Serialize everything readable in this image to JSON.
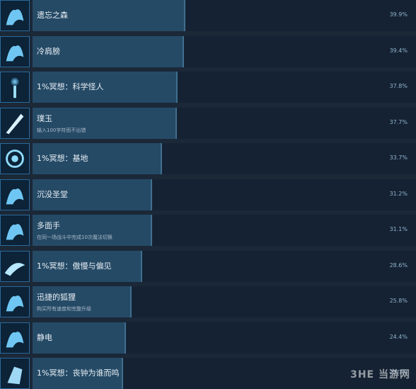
{
  "achievements": [
    {
      "name": "遗忘之森",
      "desc": "",
      "percent": "39.9%",
      "fill": 0.399,
      "icon": "wolf-forest-icon"
    },
    {
      "name": "冷肩膀",
      "desc": "",
      "percent": "39.4%",
      "fill": 0.394,
      "icon": "cold-shoulder-icon"
    },
    {
      "name": "1%冥想：科学怪人",
      "desc": "",
      "percent": "37.8%",
      "fill": 0.378,
      "icon": "lightning-tower-icon"
    },
    {
      "name": "璞玉",
      "desc": "输入100字符而不出错",
      "percent": "37.7%",
      "fill": 0.377,
      "icon": "quill-icon"
    },
    {
      "name": "1%冥想：基地",
      "desc": "",
      "percent": "33.7%",
      "fill": 0.337,
      "icon": "vortex-base-icon"
    },
    {
      "name": "沉没圣堂",
      "desc": "",
      "percent": "31.2%",
      "fill": 0.312,
      "icon": "sunken-temple-icon"
    },
    {
      "name": "多面手",
      "desc": "在同一场战斗中完成10次魔法切换",
      "percent": "31.1%",
      "fill": 0.311,
      "icon": "multitask-icon"
    },
    {
      "name": "1%冥想：傲慢与偏见",
      "desc": "",
      "percent": "28.6%",
      "fill": 0.286,
      "icon": "swan-icon"
    },
    {
      "name": "迅捷的狐狸",
      "desc": "购买所有速度和完整升级",
      "percent": "25.8%",
      "fill": 0.258,
      "icon": "fox-icon"
    },
    {
      "name": "静电",
      "desc": "",
      "percent": "24.4%",
      "fill": 0.244,
      "icon": "static-wolf-icon"
    },
    {
      "name": "1%冥想：丧钟为谁而鸣",
      "desc": "",
      "percent": "23.7%",
      "fill": 0.237,
      "icon": "bell-icon"
    }
  ],
  "watermark": {
    "text": "当游网"
  },
  "colors": {
    "background": "#1b2838",
    "bar_fill": "#254a66",
    "bar_bg": "#152233",
    "percent": "#8fb4cf"
  }
}
